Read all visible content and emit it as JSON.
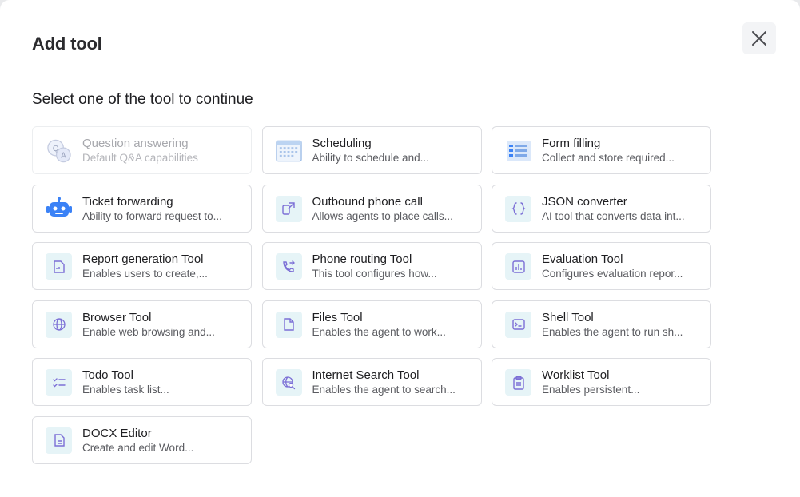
{
  "modal": {
    "title": "Add tool",
    "subtitle": "Select one of the tool to continue"
  },
  "tools": [
    {
      "name": "Question answering",
      "desc": "Default Q&A capabilities",
      "icon": "qa-icon",
      "disabled": true
    },
    {
      "name": "Scheduling",
      "desc": "Ability to schedule and...",
      "icon": "calendar-icon"
    },
    {
      "name": "Form filling",
      "desc": "Collect and store required...",
      "icon": "form-icon"
    },
    {
      "name": "Ticket forwarding",
      "desc": "Ability to forward request to...",
      "icon": "robot-icon"
    },
    {
      "name": "Outbound phone call",
      "desc": "Allows agents to place calls...",
      "icon": "outbound-call-icon"
    },
    {
      "name": "JSON converter",
      "desc": "AI tool that converts data int...",
      "icon": "braces-icon"
    },
    {
      "name": "Report generation Tool",
      "desc": "Enables users to create,...",
      "icon": "report-icon"
    },
    {
      "name": "Phone routing Tool",
      "desc": "This tool configures how...",
      "icon": "phone-routing-icon"
    },
    {
      "name": "Evaluation Tool",
      "desc": "Configures evaluation repor...",
      "icon": "bar-chart-icon"
    },
    {
      "name": "Browser Tool",
      "desc": "Enable web browsing and...",
      "icon": "globe-icon"
    },
    {
      "name": "Files Tool",
      "desc": "Enables the agent to work...",
      "icon": "file-icon"
    },
    {
      "name": "Shell Tool",
      "desc": "Enables the agent to run sh...",
      "icon": "terminal-icon"
    },
    {
      "name": "Todo Tool",
      "desc": "Enables task list...",
      "icon": "checklist-icon"
    },
    {
      "name": "Internet Search Tool",
      "desc": "Enables the agent to search...",
      "icon": "web-search-icon"
    },
    {
      "name": "Worklist Tool",
      "desc": "Enables persistent...",
      "icon": "clipboard-icon"
    },
    {
      "name": "DOCX Editor",
      "desc": "Create and edit Word...",
      "icon": "document-icon"
    }
  ],
  "colors": {
    "icon_bg": "#e6f4f7",
    "icon_purple": "#7c6fd6",
    "icon_blue": "#3b82f6",
    "card_border": "#dcdde1"
  }
}
